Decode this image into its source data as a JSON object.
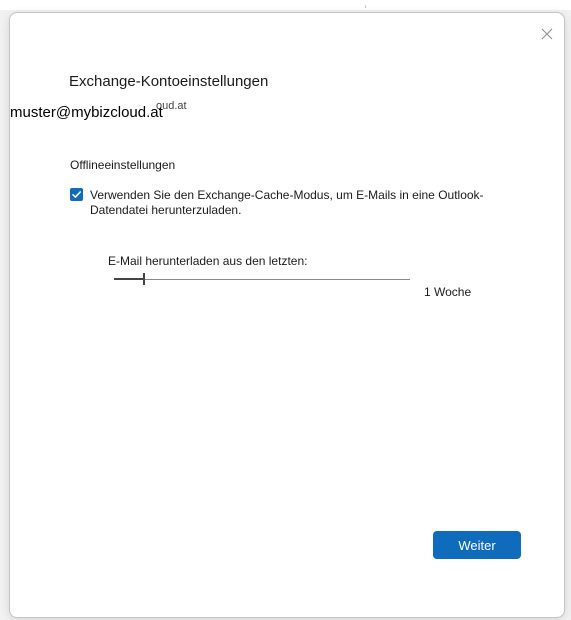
{
  "dialog": {
    "title": "Exchange-Kontoeinstellungen",
    "account_email_partial": "oud.at",
    "account_email": "muster@mybizcloud.at",
    "close_icon": "close-icon"
  },
  "offline": {
    "section_label": "Offlineeinstellungen",
    "cache_mode": {
      "checked": true,
      "label": "Verwenden Sie den Exchange-Cache-Modus, um E-Mails in eine Outlook-Datendatei herunterzuladen."
    },
    "download": {
      "label": "E-Mail herunterladen aus den letzten:",
      "value_text": "1 Woche",
      "level": 0.1
    }
  },
  "footer": {
    "next_button_label": "Weiter"
  },
  "colors": {
    "accent": "#0f6cbd"
  }
}
